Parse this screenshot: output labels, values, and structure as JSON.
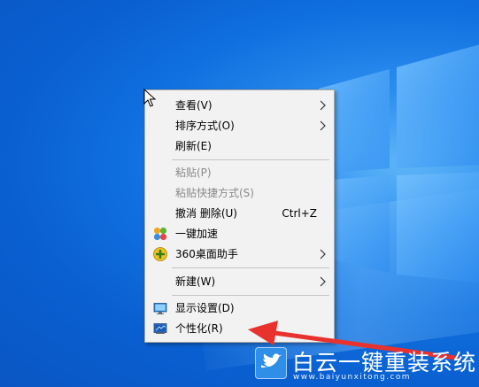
{
  "desktop": {
    "background": "#0a64d4"
  },
  "context_menu": {
    "items": [
      {
        "label": "查看(V)",
        "enabled": true,
        "submenu": true
      },
      {
        "label": "排序方式(O)",
        "enabled": true,
        "submenu": true
      },
      {
        "label": "刷新(E)",
        "enabled": true
      },
      {
        "label": "粘贴(P)",
        "enabled": false
      },
      {
        "label": "粘贴快捷方式(S)",
        "enabled": false
      },
      {
        "label": "撤消 删除(U)",
        "enabled": true,
        "shortcut": "Ctrl+Z"
      },
      {
        "label": "一键加速",
        "enabled": true,
        "icon": "speedup-icon"
      },
      {
        "label": "360桌面助手",
        "enabled": true,
        "submenu": true,
        "icon": "360-assistant-icon"
      },
      {
        "label": "新建(W)",
        "enabled": true,
        "submenu": true
      },
      {
        "label": "显示设置(D)",
        "enabled": true,
        "icon": "display-settings-icon"
      },
      {
        "label": "个性化(R)",
        "enabled": true,
        "icon": "personalize-icon"
      }
    ]
  },
  "annotation": {
    "color": "#e8322e"
  },
  "watermark": {
    "title": "白云一键重装系统",
    "url": "www.baiyunxitong.com"
  }
}
